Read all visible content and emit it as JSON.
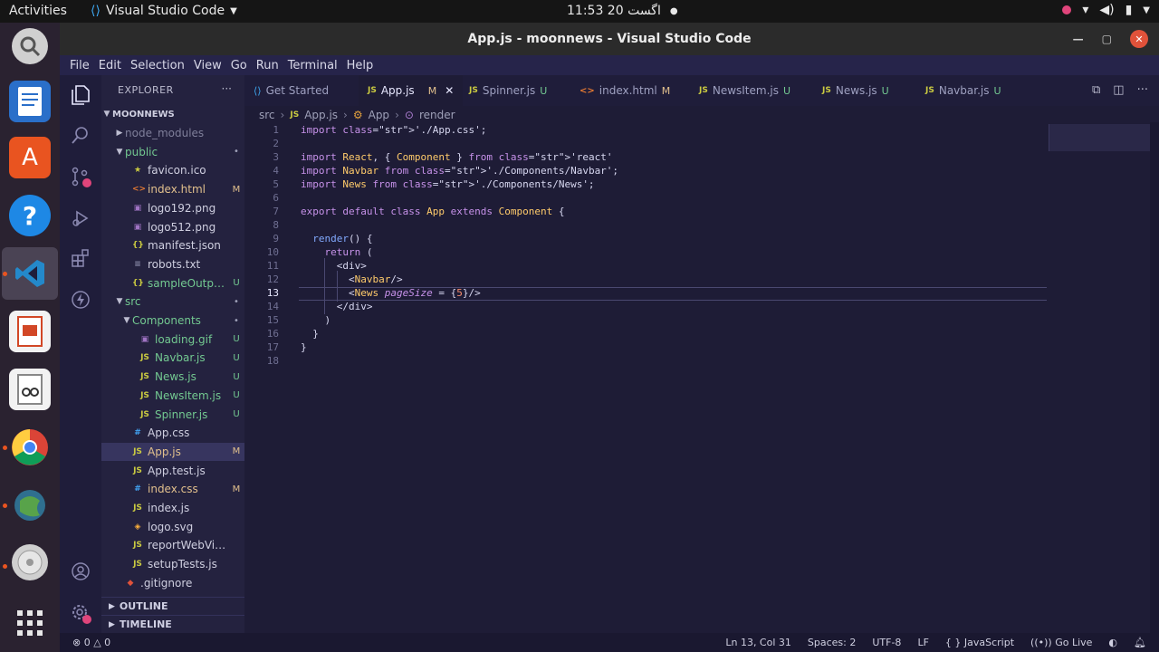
{
  "topbar": {
    "activities": "Activities",
    "app_name": "Visual Studio Code",
    "clock": "11:53  اگست 20"
  },
  "window": {
    "title": "App.js - moonnews - Visual Studio Code"
  },
  "menu": [
    "File",
    "Edit",
    "Selection",
    "View",
    "Go",
    "Run",
    "Terminal",
    "Help"
  ],
  "explorer": {
    "header": "EXPLORER",
    "root": "MOONNEWS",
    "items": [
      {
        "name": "node_modules",
        "type": "folder",
        "badge": ""
      },
      {
        "name": "public",
        "type": "folder",
        "badge": "•"
      },
      {
        "name": "favicon.ico",
        "type": "star",
        "badge": ""
      },
      {
        "name": "index.html",
        "type": "html",
        "badge": "M"
      },
      {
        "name": "logo192.png",
        "type": "img",
        "badge": ""
      },
      {
        "name": "logo512.png",
        "type": "img",
        "badge": ""
      },
      {
        "name": "manifest.json",
        "type": "json",
        "badge": ""
      },
      {
        "name": "robots.txt",
        "type": "txt",
        "badge": ""
      },
      {
        "name": "sampleOutput...",
        "type": "json",
        "badge": "U"
      },
      {
        "name": "src",
        "type": "folder",
        "badge": "•"
      },
      {
        "name": "Components",
        "type": "folder",
        "badge": "•"
      },
      {
        "name": "loading.gif",
        "type": "img",
        "badge": "U"
      },
      {
        "name": "Navbar.js",
        "type": "js",
        "badge": "U"
      },
      {
        "name": "News.js",
        "type": "js",
        "badge": "U"
      },
      {
        "name": "NewsItem.js",
        "type": "js",
        "badge": "U"
      },
      {
        "name": "Spinner.js",
        "type": "js",
        "badge": "U"
      },
      {
        "name": "App.css",
        "type": "css",
        "badge": ""
      },
      {
        "name": "App.js",
        "type": "js",
        "badge": "M"
      },
      {
        "name": "App.test.js",
        "type": "js",
        "badge": ""
      },
      {
        "name": "index.css",
        "type": "css",
        "badge": "M"
      },
      {
        "name": "index.js",
        "type": "js",
        "badge": ""
      },
      {
        "name": "logo.svg",
        "type": "svg",
        "badge": ""
      },
      {
        "name": "reportWebVitals.js",
        "type": "js",
        "badge": ""
      },
      {
        "name": "setupTests.js",
        "type": "js",
        "badge": ""
      },
      {
        "name": ".gitignore",
        "type": "git",
        "badge": ""
      }
    ],
    "outline": "OUTLINE",
    "timeline": "TIMELINE"
  },
  "tabs": [
    {
      "label": "Get Started",
      "kind": "vscode",
      "mod": ""
    },
    {
      "label": "App.js",
      "kind": "js",
      "mod": "M"
    },
    {
      "label": "Spinner.js",
      "kind": "js",
      "mod": "U"
    },
    {
      "label": "index.html",
      "kind": "html",
      "mod": "M"
    },
    {
      "label": "NewsItem.js",
      "kind": "js",
      "mod": "U"
    },
    {
      "label": "News.js",
      "kind": "js",
      "mod": "U"
    },
    {
      "label": "Navbar.js",
      "kind": "js",
      "mod": "U"
    }
  ],
  "breadcrumb": [
    "src",
    "App.js",
    "App",
    "render"
  ],
  "code": {
    "current_line": 13,
    "lines": [
      "import './App.css';",
      "",
      "import React, { Component } from 'react'",
      "import Navbar from './Components/Navbar';",
      "import News from './Components/News';",
      "",
      "export default class App extends Component {",
      "",
      "  render() {",
      "    return (",
      "      <div>",
      "        <Navbar/>",
      "        <News pageSize = {5}/>",
      "      </div>",
      "    )",
      "  }",
      "}",
      ""
    ]
  },
  "status": {
    "problems": "⊗ 0 △ 0",
    "position": "Ln 13, Col 31",
    "spaces": "Spaces: 2",
    "encoding": "UTF-8",
    "eol": "LF",
    "language": "{ } JavaScript",
    "golive": "Go Live"
  }
}
